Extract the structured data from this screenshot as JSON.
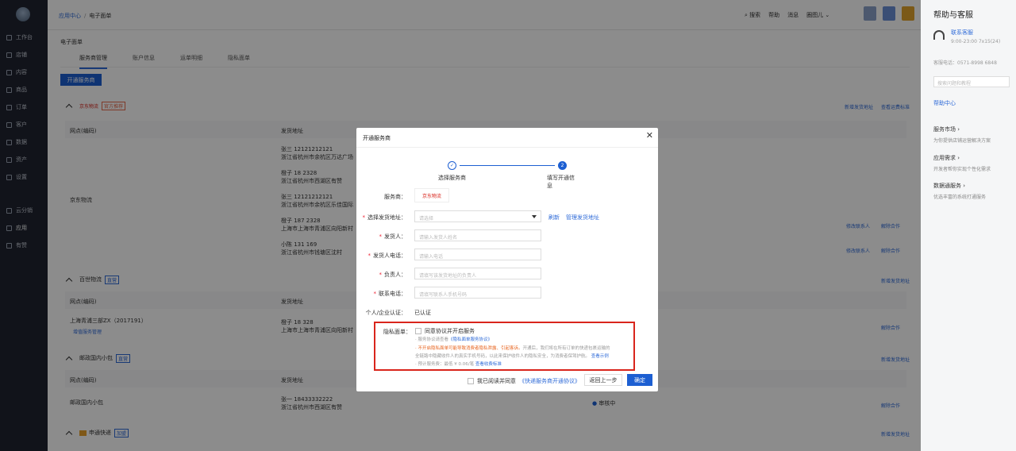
{
  "sidebar": {
    "items": [
      {
        "label": "工作台"
      },
      {
        "label": "店铺"
      },
      {
        "label": "内容"
      },
      {
        "label": "商品"
      },
      {
        "label": "订单"
      },
      {
        "label": "客户"
      },
      {
        "label": "数据"
      },
      {
        "label": "资产"
      },
      {
        "label": "设置"
      },
      {
        "label": "云分销"
      },
      {
        "label": "应用"
      },
      {
        "label": "有赞"
      }
    ]
  },
  "header": {
    "breadcrumb_link": "应用中心",
    "breadcrumb_sep": "/",
    "breadcrumb_current": "电子面单",
    "search": "搜索",
    "help": "帮助",
    "messages": "消息",
    "user": "圈图儿"
  },
  "page": {
    "title": "电子面单",
    "tabs": [
      "服务商管理",
      "账户信息",
      "运单明细",
      "隐私面单"
    ],
    "open_button": "开通服务商"
  },
  "sections": {
    "jd": {
      "tag": "官方推荐",
      "actions": [
        "新增发货地址",
        "查看运费标准"
      ],
      "col1": "网点(编码)",
      "col2": "发货地址",
      "network": "京东物流",
      "addresses": [
        {
          "l1": "张三 12121212121",
          "l2": "浙江省杭州市余杭区万达广场"
        },
        {
          "l1": "橙子 18         2328",
          "l2": "浙江省杭州市西湖区有赞"
        },
        {
          "l1": "张三 12121212121",
          "l2": "浙江省杭州市余杭区乐佳国际"
        },
        {
          "l1": "橙子 187       2328",
          "l2": "上海市上海市青浦区向阳新村"
        },
        {
          "l1": "小陈 131        169",
          "l2": "浙江省杭州市钱塘区沈村"
        }
      ],
      "row_actions": [
        "修改联系人",
        "解除合作"
      ]
    },
    "baishi": {
      "name": "百世物流",
      "tag": "直营",
      "action": "新增发货地址",
      "col1": "网点(编码)",
      "col2": "发货地址",
      "network": "上海青浦三部ZX（2017191）",
      "network_link": "增值服务管理",
      "addr_l1": "橙子 18         328",
      "addr_l2": "上海市上海市青浦区向阳新村",
      "row_action": "解除合作"
    },
    "youzheng": {
      "name": "邮政国内小包",
      "tag": "直营",
      "action": "新增发货地址",
      "col1": "网点(编码)",
      "col2": "发货地址",
      "network": "邮政国内小包",
      "addr_l1": "张一 18433332222",
      "addr_l2": "浙江省杭州市西湖区有赞",
      "status": "审核中",
      "row_action": "解除合作"
    },
    "shentong": {
      "name": "申通快递",
      "tag": "加盟",
      "action": "新增发货地址"
    }
  },
  "help_panel": {
    "title": "帮助与客服",
    "contact_name": "联系客服",
    "contact_time": "9:00-23:00  7x15(24)",
    "phone": "客服电话：0571-8998 6848",
    "search_placeholder": "搜索问题和教程",
    "center": "帮助中心",
    "sections": [
      {
        "title": "服务市场 ›",
        "desc": "为你提供店铺运营解决方案"
      },
      {
        "title": "应用需求 ›",
        "desc": "开发者帮你实现个性化需求"
      },
      {
        "title": "数据通服务 ›",
        "desc": "优选丰富的系统打通服务"
      }
    ]
  },
  "modal": {
    "title": "开通服务商",
    "close": "✕",
    "step1_icon": "✓",
    "step2_num": "2",
    "step1": "选择服务商",
    "step2": "填写开通信息",
    "provider_label": "服务商：",
    "provider_logo": "京东物流",
    "address_label": "选择发货地址：",
    "address_placeholder": "请选择",
    "refresh": "刷新",
    "manage_address": "管理发货地址",
    "sender_label": "发货人：",
    "sender_placeholder": "请输入发货人姓名",
    "sender_phone_label": "发货人电话：",
    "sender_phone_placeholder": "请输入电话",
    "principal_label": "负责人：",
    "principal_placeholder": "请填写该发货地址的负责人",
    "contact_phone_label": "联系电话：",
    "contact_phone_placeholder": "请填写联系人手机号码",
    "cert_label": "个人/企业认证：",
    "cert_value": "已认证",
    "privacy_label": "隐私面单：",
    "privacy_check": "同意协议并开启服务",
    "privacy_line1_prefix": "· 服务协议请查看",
    "privacy_line1_link": "《隐私面单服务协议》",
    "privacy_line2_orange": "· 不开启隐私面单可能导致消费者隐私泄露、引起客诉。",
    "privacy_line2_rest": "开通后，我们将在所有订单的快递包裹运输的",
    "privacy_line3": "全链路中隐藏收件人的真实手机号码，以此来保护收件人的隐私安全，为消费者保驾护航。",
    "privacy_line3_link": "查看示例",
    "privacy_line4": "· 预计服务费：最低 ¥ 0.06/笔",
    "privacy_line4_link": "查看收费标准",
    "agree_prefix": "我已阅读并同意",
    "agree_link": "《快递服务商开通协议》",
    "back": "返回上一步",
    "confirm": "确定"
  },
  "colors": {
    "primary": "#1d5fd2",
    "highlight_border": "#d9251c",
    "warning": "#e8641e"
  }
}
